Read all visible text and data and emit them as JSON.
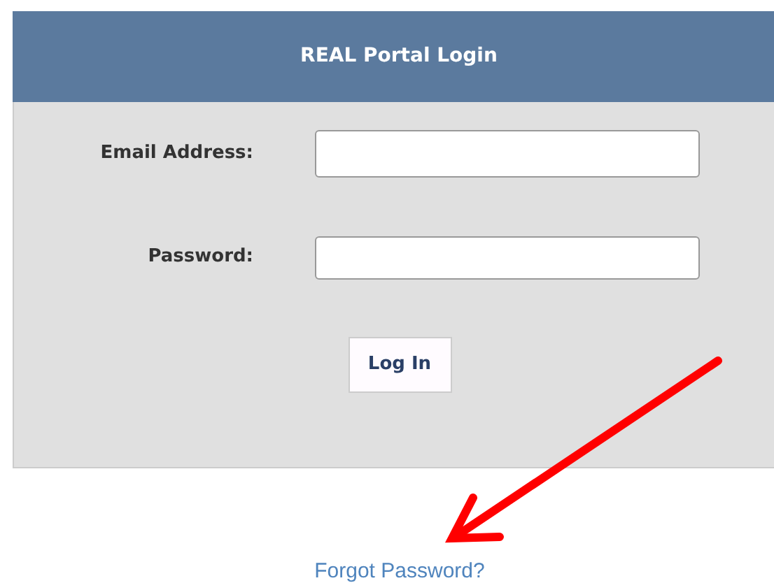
{
  "panel": {
    "title": "REAL Portal Login"
  },
  "fields": [
    {
      "label": "Email Address:",
      "kind": "text"
    },
    {
      "label": "Password:",
      "kind": "password"
    }
  ],
  "login_button": "Log In",
  "forgot_link": "Forgot Password?"
}
